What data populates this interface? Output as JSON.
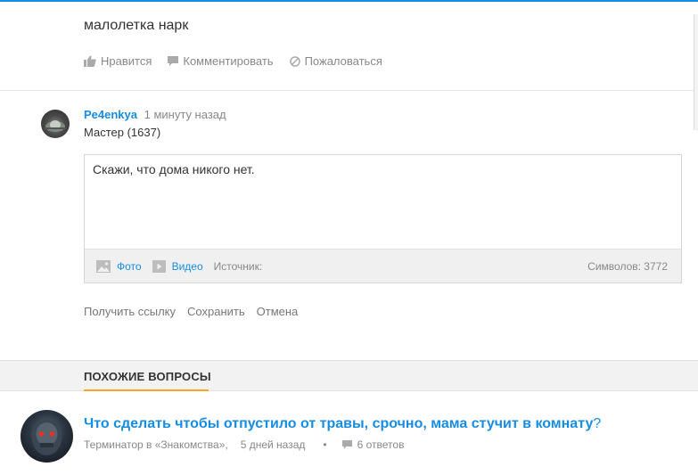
{
  "answer": {
    "text": "малолетка нарк",
    "actions": {
      "like": "Нравится",
      "comment": "Комментировать",
      "report": "Пожаловаться"
    }
  },
  "reply": {
    "author_name": "Pe4enkya",
    "time": "1 минуту назад",
    "rank": "Мастер (1637)",
    "editor_text": "Скажи, что дома никого нет.",
    "toolbar": {
      "photo": "Фото",
      "video": "Видео",
      "source": "Источник:",
      "chars": "Символов: 3772"
    },
    "form_actions": {
      "get_link": "Получить ссылку",
      "save": "Сохранить",
      "cancel": "Отмена"
    }
  },
  "similar": {
    "heading": "ПОХОЖИЕ ВОПРОСЫ",
    "items": [
      {
        "title": "Что сделать чтобы отпустило от травы, срочно, мама стучит в комнату",
        "qmark": "?",
        "meta": "Терминатор в «Знакомства»,",
        "time": "5 дней назад",
        "bullet": "•",
        "answers": "6 ответов"
      }
    ]
  },
  "colors": {
    "accent": "#168de2",
    "tab_underline": "#f5a623",
    "muted": "#888888"
  },
  "icons": [
    "thumbs-up-icon",
    "comment-icon",
    "report-icon",
    "photo-icon",
    "video-icon",
    "comment-bubble-icon"
  ]
}
